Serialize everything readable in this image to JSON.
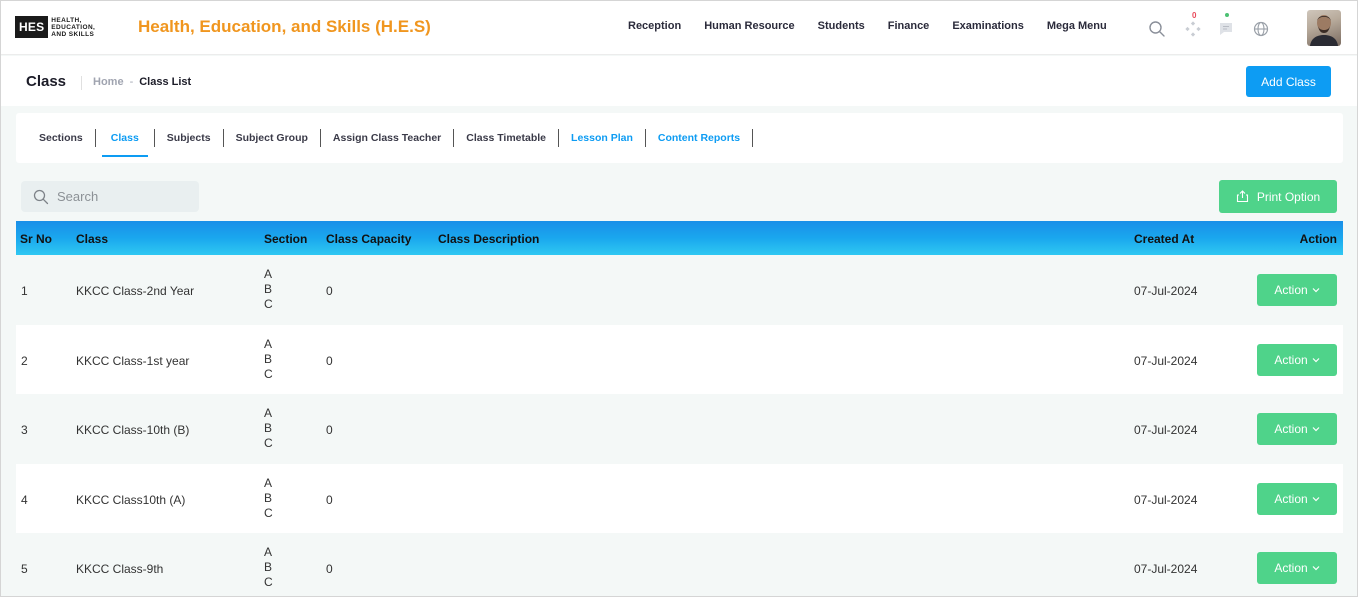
{
  "header": {
    "logo_text": "HES",
    "logo_sub": [
      "HEALTH,",
      "EDUCATION,",
      "AND SKILLS"
    ],
    "brand_title": "Health, Education, and Skills (H.E.S)",
    "nav": [
      "Reception",
      "Human Resource",
      "Students",
      "Finance",
      "Examinations",
      "Mega Menu"
    ],
    "notification_count": "0"
  },
  "subheader": {
    "title": "Class",
    "breadcrumb_home": "Home",
    "breadcrumb_sep": "-",
    "breadcrumb_current": "Class List",
    "add_button": "Add Class"
  },
  "tabs": [
    {
      "label": "Sections",
      "state": "normal"
    },
    {
      "label": "Class",
      "state": "active"
    },
    {
      "label": "Subjects",
      "state": "normal"
    },
    {
      "label": "Subject Group",
      "state": "normal"
    },
    {
      "label": "Assign Class Teacher",
      "state": "normal"
    },
    {
      "label": "Class Timetable",
      "state": "normal"
    },
    {
      "label": "Lesson Plan",
      "state": "link"
    },
    {
      "label": "Content Reports",
      "state": "link"
    }
  ],
  "toolbar": {
    "search_placeholder": "Search",
    "print_label": "Print Option"
  },
  "table": {
    "columns": [
      "Sr No",
      "Class",
      "Section",
      "Class Capacity",
      "Class Description",
      "Created At",
      "Action"
    ],
    "rows": [
      {
        "sr": "1",
        "class": "KKCC Class-2nd Year",
        "sections": [
          "A",
          "B",
          "C"
        ],
        "capacity": "0",
        "description": "",
        "created": "07-Jul-2024",
        "action": "Action"
      },
      {
        "sr": "2",
        "class": "KKCC Class-1st year",
        "sections": [
          "A",
          "B",
          "C"
        ],
        "capacity": "0",
        "description": "",
        "created": "07-Jul-2024",
        "action": "Action"
      },
      {
        "sr": "3",
        "class": "KKCC Class-10th (B)",
        "sections": [
          "A",
          "B",
          "C"
        ],
        "capacity": "0",
        "description": "",
        "created": "07-Jul-2024",
        "action": "Action"
      },
      {
        "sr": "4",
        "class": "KKCC Class10th (A)",
        "sections": [
          "A",
          "B",
          "C"
        ],
        "capacity": "0",
        "description": "",
        "created": "07-Jul-2024",
        "action": "Action"
      },
      {
        "sr": "5",
        "class": "KKCC Class-9th",
        "sections": [
          "A",
          "B",
          "C"
        ],
        "capacity": "0",
        "description": "",
        "created": "07-Jul-2024",
        "action": "Action"
      }
    ]
  },
  "colors": {
    "brand_orange": "#f0961f",
    "primary_blue": "#0d9cf3",
    "action_green": "#4fd38a",
    "badge_red": "#e8495a"
  },
  "icons": {
    "search": "search-icon",
    "apps": "apps-icon",
    "chat": "chat-icon",
    "globe": "globe-icon",
    "print": "share-upload-icon",
    "chevron": "chevron-down-icon"
  }
}
